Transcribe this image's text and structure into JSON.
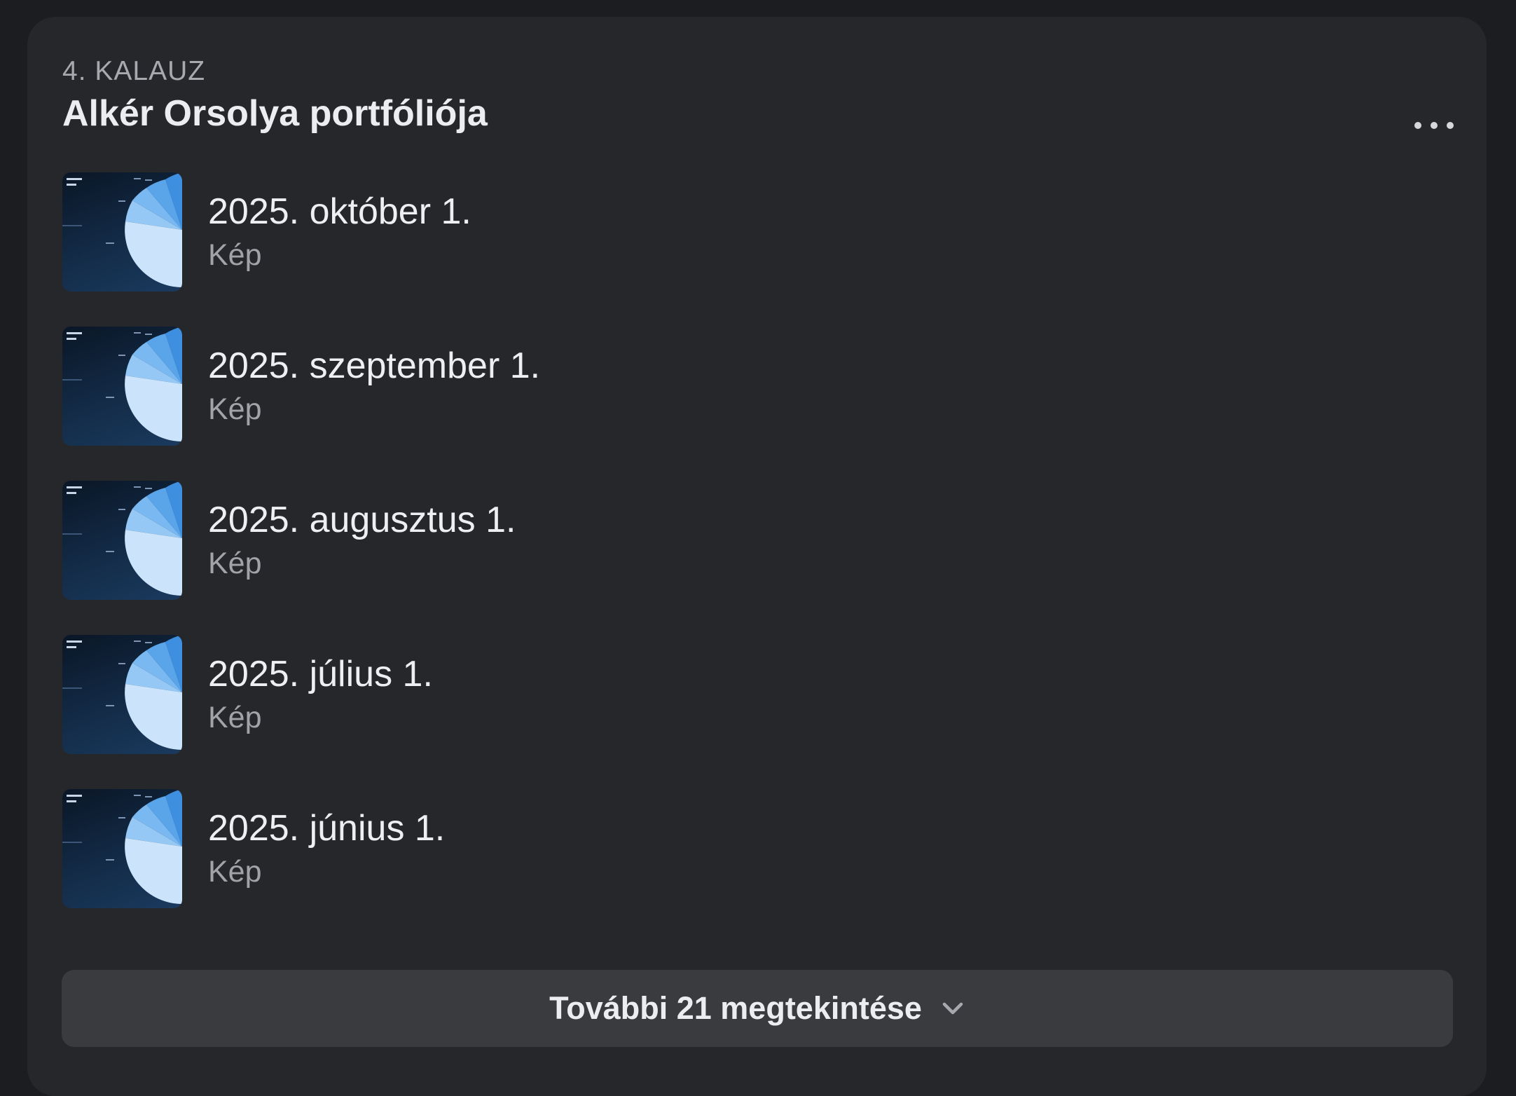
{
  "section": {
    "eyebrow": "4. KALAUZ",
    "title": "Alkér Orsolya portfóliója",
    "more_icon": "ellipsis-icon"
  },
  "items": [
    {
      "date": "2025. október 1.",
      "type": "Kép",
      "thumbnail_icon": "pie-chart-thumbnail"
    },
    {
      "date": "2025. szeptember 1.",
      "type": "Kép",
      "thumbnail_icon": "pie-chart-thumbnail"
    },
    {
      "date": "2025. augusztus 1.",
      "type": "Kép",
      "thumbnail_icon": "pie-chart-thumbnail"
    },
    {
      "date": "2025. július 1.",
      "type": "Kép",
      "thumbnail_icon": "pie-chart-thumbnail"
    },
    {
      "date": "2025. június 1.",
      "type": "Kép",
      "thumbnail_icon": "pie-chart-thumbnail"
    }
  ],
  "expand": {
    "label": "További 21 megtekintése",
    "icon": "chevron-down-icon"
  },
  "colors": {
    "page_background": "#1c1d20",
    "card_background": "#26272b",
    "button_background": "#3a3b3f",
    "primary_text": "#eeeff2",
    "secondary_text": "#a2a3a8"
  }
}
